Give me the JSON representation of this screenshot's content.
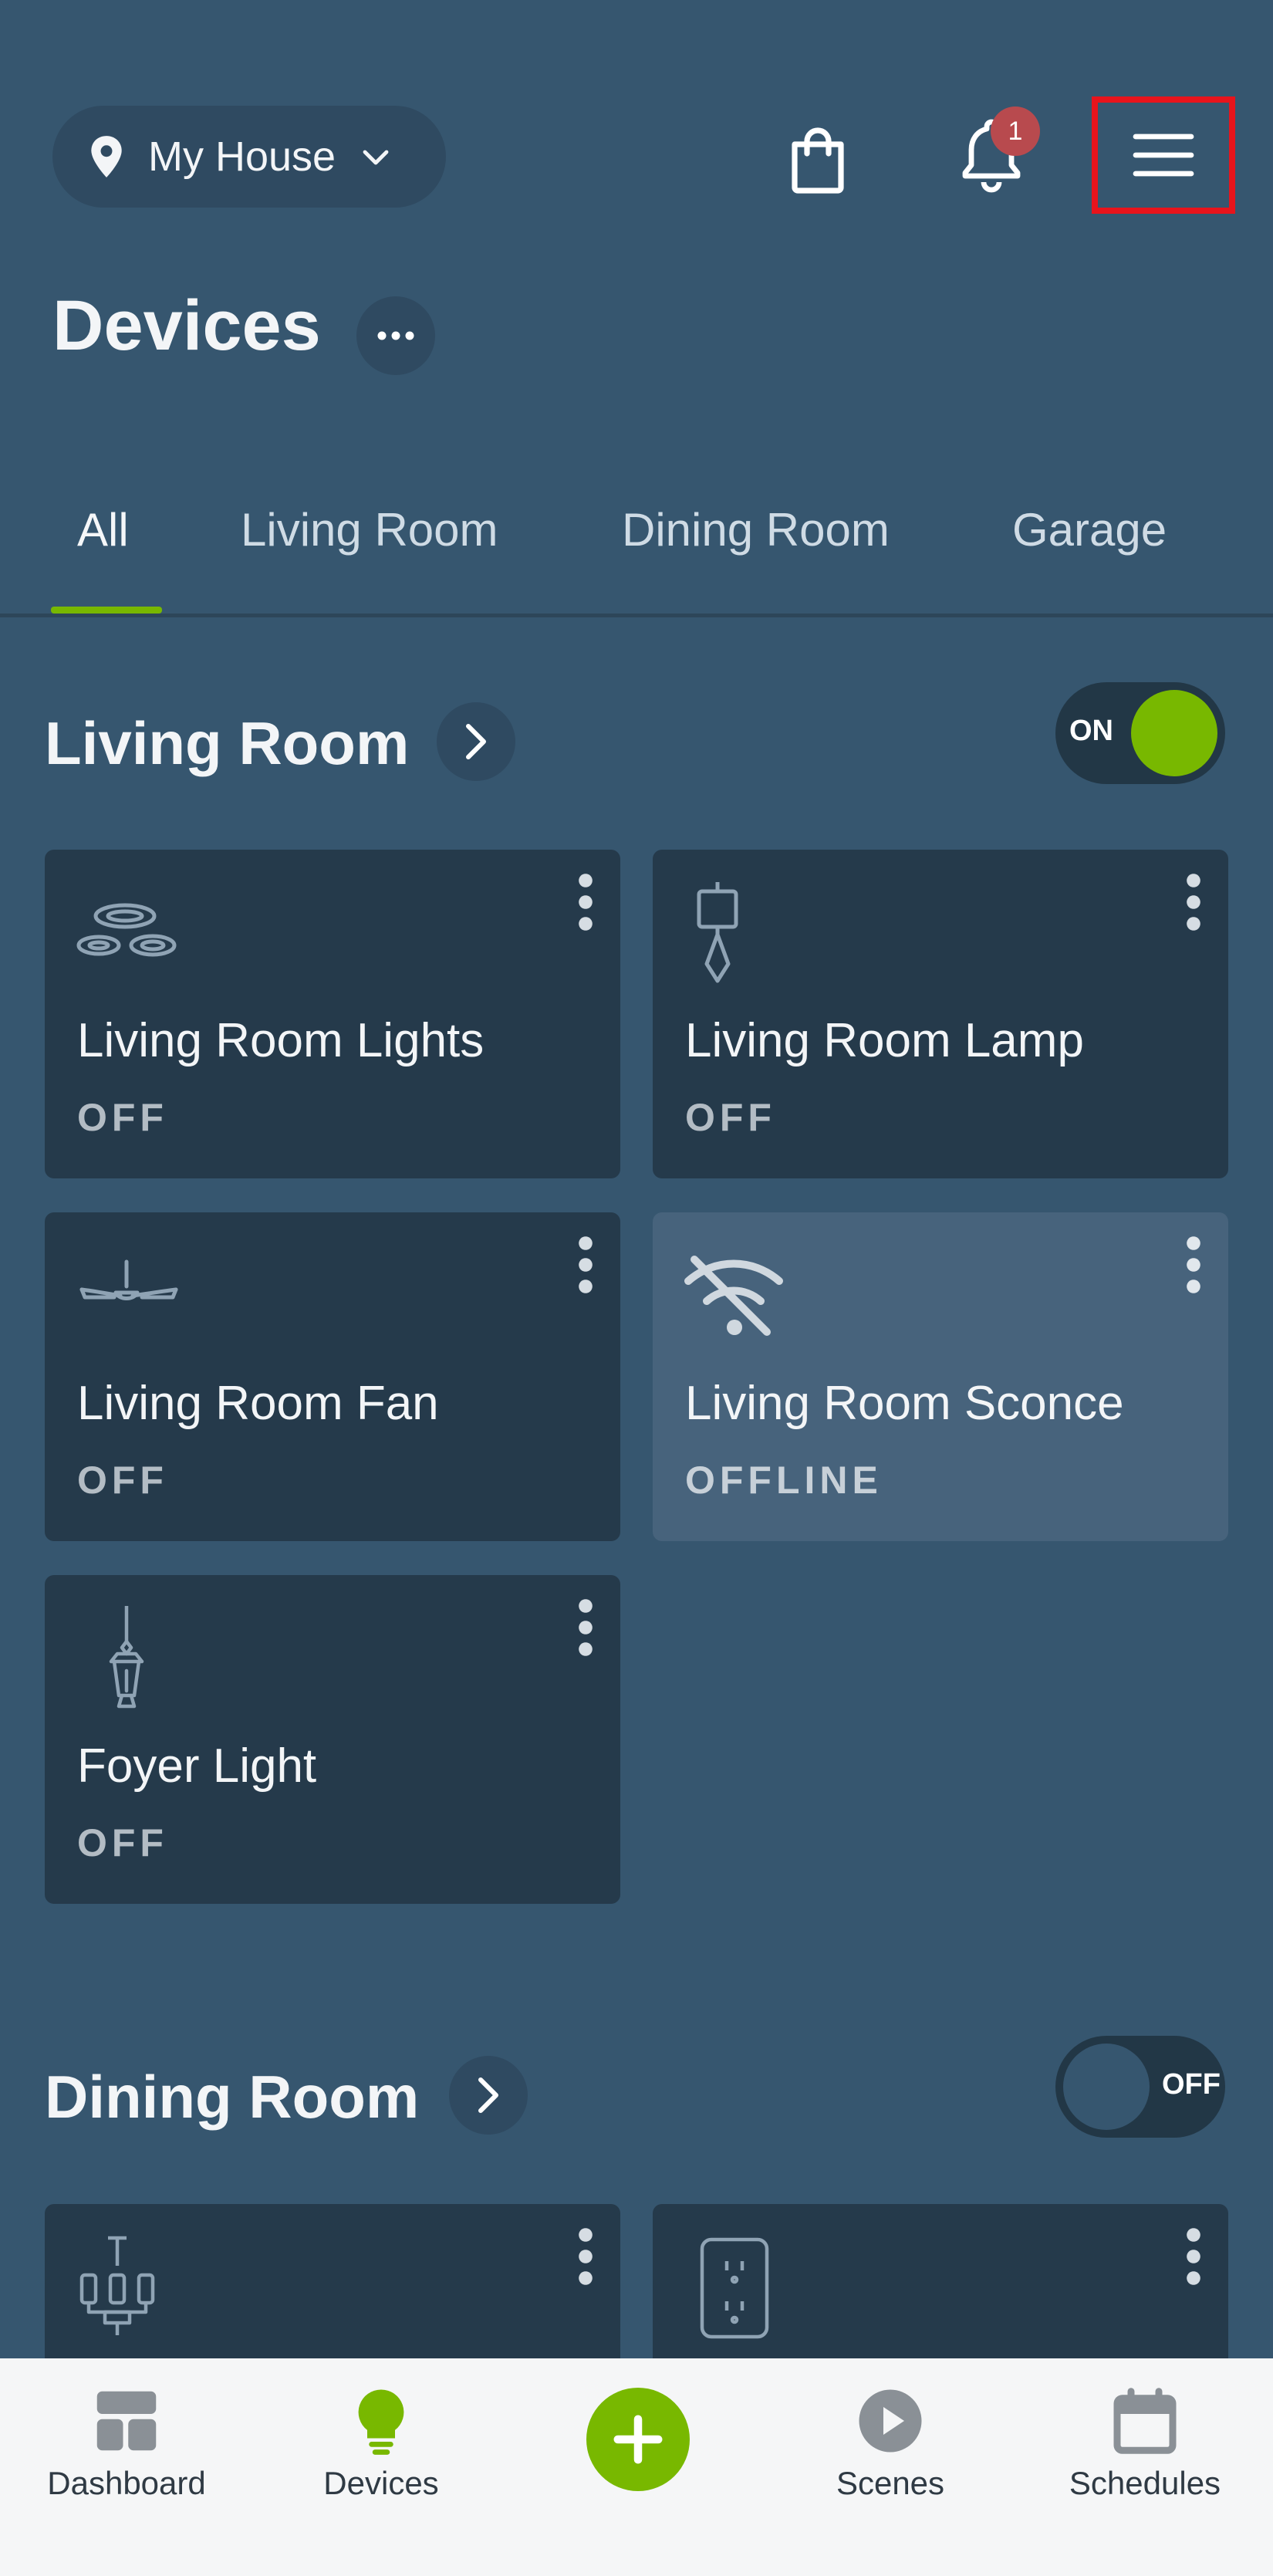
{
  "header": {
    "location_label": "My House",
    "notification_count": "1"
  },
  "page": {
    "title": "Devices"
  },
  "tabs": [
    {
      "label": "All",
      "active": true
    },
    {
      "label": "Living Room"
    },
    {
      "label": "Dining Room"
    },
    {
      "label": "Garage"
    }
  ],
  "sections": {
    "living_room": {
      "title": "Living Room",
      "toggle_label": "ON",
      "devices": [
        {
          "name": "Living Room Lights",
          "state": "OFF",
          "icon": "ceiling-lights-icon"
        },
        {
          "name": "Living Room Lamp",
          "state": "OFF",
          "icon": "lamp-icon"
        },
        {
          "name": "Living Room Fan",
          "state": "OFF",
          "icon": "ceiling-fan-icon"
        },
        {
          "name": "Living Room Sconce",
          "state": "OFFLINE",
          "icon": "wifi-off-icon"
        },
        {
          "name": "Foyer Light",
          "state": "OFF",
          "icon": "pendant-lantern-icon"
        }
      ]
    },
    "dining_room": {
      "title": "Dining Room",
      "toggle_label": "OFF",
      "devices": [
        {
          "icon": "chandelier-icon"
        },
        {
          "icon": "outlet-icon"
        }
      ]
    }
  },
  "bottom_nav": {
    "dashboard": "Dashboard",
    "devices": "Devices",
    "scenes": "Scenes",
    "schedules": "Schedules"
  },
  "colors": {
    "background": "#36566f",
    "card": "#253a4b",
    "accent": "#78b800",
    "badge": "#b84a4e"
  }
}
